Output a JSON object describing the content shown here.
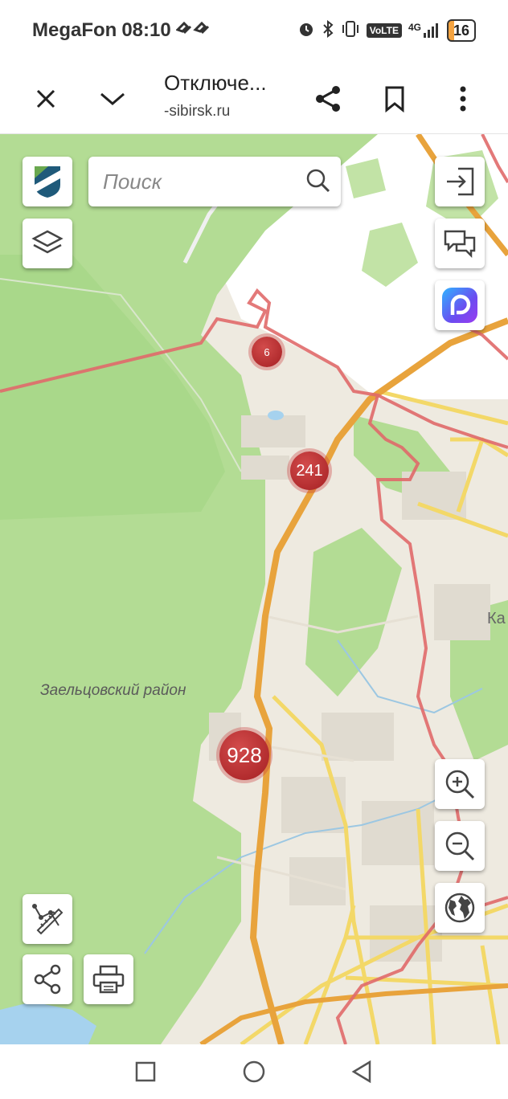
{
  "status_bar": {
    "carrier": "MegaFon",
    "time": "08:10",
    "network": "4G",
    "volte": "VoLTE",
    "battery": "16"
  },
  "browser": {
    "title": "Отключе...",
    "url": "-sibirsk.ru"
  },
  "map": {
    "search_placeholder": "Поиск",
    "clusters": [
      {
        "count": "6"
      },
      {
        "count": "241"
      },
      {
        "count": "928"
      }
    ],
    "district_label": "Заельцовский район",
    "edge_label": "Ка"
  },
  "colors": {
    "forest": "#a9d88a",
    "land": "#eeeae0",
    "road_major": "#e8a33c",
    "road_minor": "#f3d868",
    "boundary": "#e06a6a",
    "cluster": "#b32a2d"
  }
}
